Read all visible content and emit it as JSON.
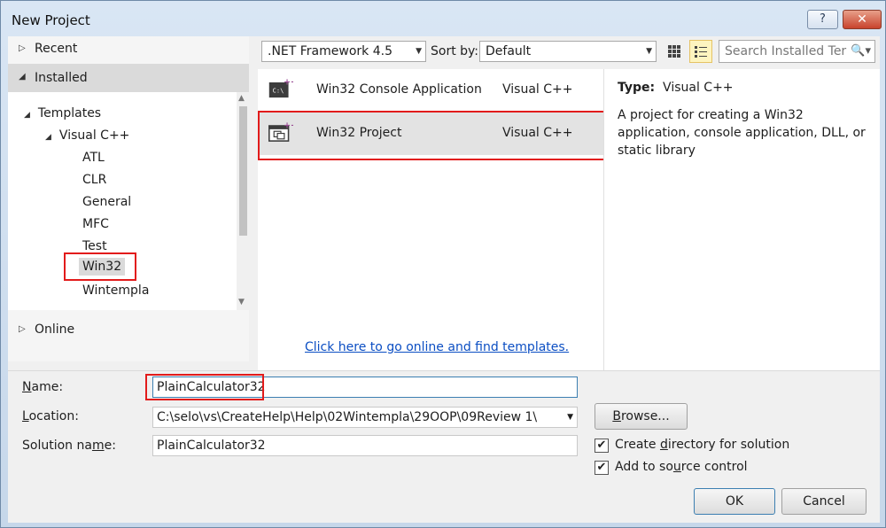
{
  "window": {
    "title": "New Project",
    "help_label": "?",
    "close_label": "✕"
  },
  "tree": {
    "recent": "Recent",
    "installed": "Installed",
    "templates": "Templates",
    "visual_cpp": "Visual C++",
    "children": [
      "ATL",
      "CLR",
      "General",
      "MFC",
      "Test",
      "Win32",
      "Wintempla"
    ],
    "online": "Online"
  },
  "toolbar": {
    "framework": ".NET Framework 4.5",
    "sort_label": "Sort by:",
    "sort_value": "Default",
    "search_placeholder": "Search Installed Ter"
  },
  "templates": [
    {
      "name": "Win32 Console Application",
      "language": "Visual C++",
      "icon": "console-app-icon"
    },
    {
      "name": "Win32 Project",
      "language": "Visual C++",
      "icon": "win32-project-icon"
    }
  ],
  "online_link": "Click here to go online and find templates.",
  "description": {
    "type_label": "Type:",
    "type_value": "Visual C++",
    "text": "A project for creating a Win32 application, console application, DLL, or static library"
  },
  "form": {
    "name_label": "Name:",
    "name_value": "PlainCalculator32",
    "location_label": "Location:",
    "location_value": "C:\\selo\\vs\\CreateHelp\\Help\\02Wintempla\\29OOP\\09Review 1\\",
    "solution_label": "Solution name:",
    "solution_value": "PlainCalculator32",
    "browse_label": "Browse...",
    "create_dir_label": "Create directory for solution",
    "add_source_label": "Add to source control",
    "ok_label": "OK",
    "cancel_label": "Cancel"
  },
  "colors": {
    "highlight_box": "#e21b1b",
    "link": "#0b4ec3",
    "selection": "#e3e3e3"
  }
}
